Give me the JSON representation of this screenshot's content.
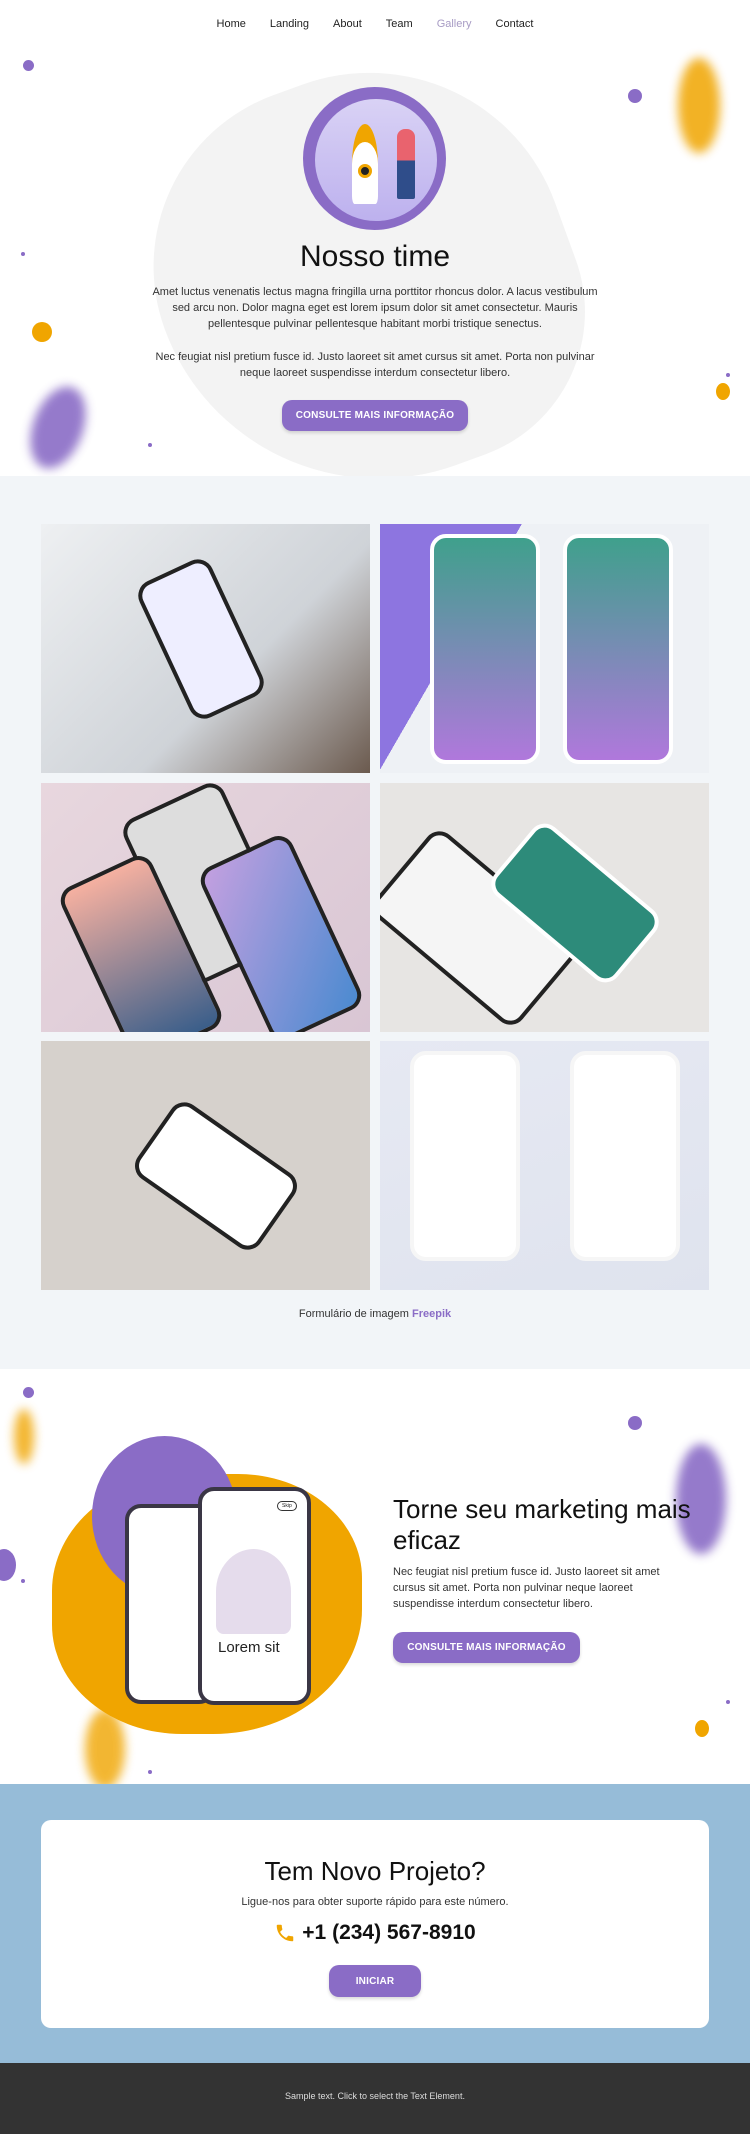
{
  "nav": {
    "items": [
      {
        "label": "Home"
      },
      {
        "label": "Landing"
      },
      {
        "label": "About"
      },
      {
        "label": "Team"
      },
      {
        "label": "Gallery",
        "active": true
      },
      {
        "label": "Contact"
      }
    ]
  },
  "colors": {
    "accent": "#8a6cc6",
    "orange": "#f0a500",
    "contact_bg": "#96bcd8",
    "footer_bg": "#333333",
    "gallery_bg": "#f2f5f8"
  },
  "hero": {
    "title": "Nosso time",
    "paragraph1": "Amet luctus venenatis lectus magna fringilla urna porttitor rhoncus dolor. A lacus vestibulum sed arcu non. Dolor magna eget est lorem ipsum dolor sit amet consectetur. Mauris pellentesque pulvinar pellentesque habitant morbi tristique senectus.",
    "paragraph2": "Nec feugiat nisl pretium fusce id. Justo laoreet sit amet cursus sit amet. Porta non pulvinar neque laoreet suspendisse interdum consectetur libero.",
    "button": "CONSULTE MAIS INFORMAÇÃO",
    "illustration": "rocket-and-person-illustration"
  },
  "gallery": {
    "images": [
      "hands-holding-phone-photo",
      "music-player-app-mockup",
      "phone-12-pro-max-mockup",
      "chat-app-mockup",
      "furniture-app-screens-mockup",
      "wallet-app-mockup"
    ],
    "caption_prefix": "Formulário de imagem",
    "caption_link": "Freepik"
  },
  "marketing": {
    "title": "Torne seu marketing mais eficaz",
    "paragraph": "Nec feugiat nisl pretium fusce id. Justo laoreet sit amet cursus sit amet. Porta non pulvinar neque laoreet suspendisse interdum consectetur libero.",
    "button": "CONSULTE MAIS INFORMAÇÃO",
    "phone_screen_title": "Lorem sit",
    "phone_skip": "Skip"
  },
  "contact": {
    "title": "Tem Novo Projeto?",
    "subtitle": "Ligue-nos para obter suporte rápido para este número.",
    "phone": "+1 (234) 567-8910",
    "phone_icon": "phone-icon",
    "button": "INICIAR"
  },
  "footer": {
    "text": "Sample text. Click to select the Text Element."
  }
}
